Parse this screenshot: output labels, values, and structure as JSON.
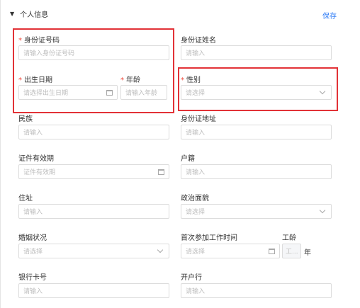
{
  "section": {
    "title": "个人信息",
    "save": "保存"
  },
  "fields": {
    "id_number": {
      "label": "身份证号码",
      "required": "*",
      "placeholder": "请输入身份证号码"
    },
    "id_name": {
      "label": "身份证姓名",
      "placeholder": "请输入"
    },
    "birth_date": {
      "label": "出生日期",
      "required": "*",
      "placeholder": "请选择出生日期"
    },
    "age": {
      "label": "年龄",
      "required": "*",
      "placeholder": "请输入年龄"
    },
    "gender": {
      "label": "性别",
      "required": "*",
      "placeholder": "请选择"
    },
    "ethnicity": {
      "label": "民族",
      "placeholder": "请输入"
    },
    "id_address": {
      "label": "身份证地址",
      "placeholder": "请输入"
    },
    "id_validity": {
      "label": "证件有效期",
      "placeholder": "证件有效期"
    },
    "household": {
      "label": "户籍",
      "placeholder": "请输入"
    },
    "residence": {
      "label": "住址",
      "placeholder": "请输入"
    },
    "political_status": {
      "label": "政治面貌",
      "placeholder": "请选择"
    },
    "marital_status": {
      "label": "婚姻状况",
      "placeholder": "请选择"
    },
    "first_work_date": {
      "label": "首次参加工作时间",
      "placeholder": "请选择"
    },
    "work_years": {
      "label": "工龄",
      "placeholder": "工...",
      "unit": "年"
    },
    "bank_card": {
      "label": "银行卡号",
      "placeholder": "请输入"
    },
    "bank": {
      "label": "开户行",
      "placeholder": "请输入"
    }
  }
}
